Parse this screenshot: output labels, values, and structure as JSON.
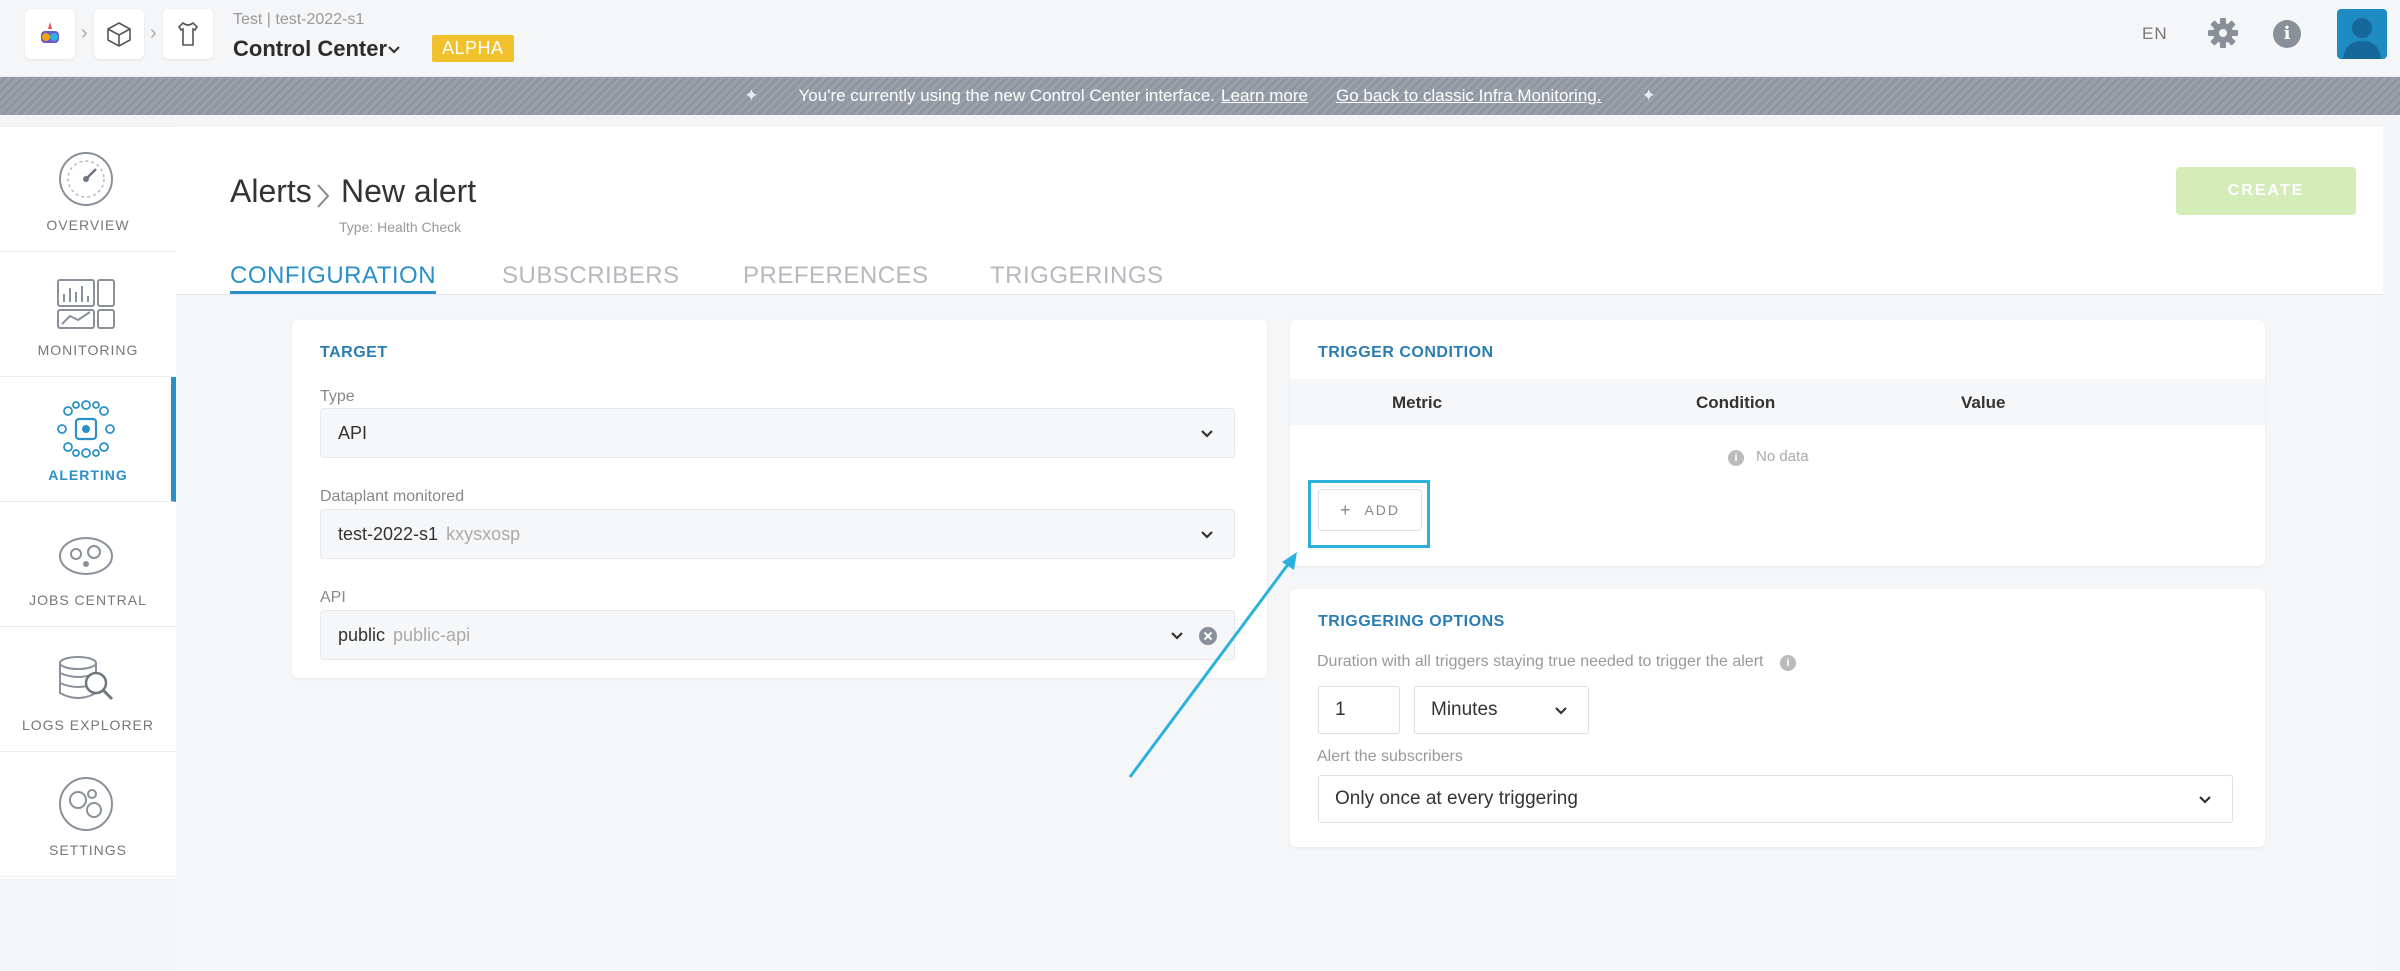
{
  "topbar": {
    "project_sub": "Test | test-2022-s1",
    "project_title": "Control Center",
    "badge": "ALPHA",
    "lang": "EN"
  },
  "banner": {
    "text": "You're currently using the new Control Center interface.",
    "learn_more": "Learn more",
    "go_back": "Go back to classic Infra Monitoring."
  },
  "sidebar": {
    "items": [
      {
        "label": "OVERVIEW",
        "icon": "gauge-icon"
      },
      {
        "label": "MONITORING",
        "icon": "monitoring-dashboard-icon"
      },
      {
        "label": "ALERTING",
        "icon": "alerting-network-icon"
      },
      {
        "label": "JOBS CENTRAL",
        "icon": "jobs-icon"
      },
      {
        "label": "LOGS EXPLORER",
        "icon": "logs-explorer-icon"
      },
      {
        "label": "SETTINGS",
        "icon": "settings-gears-icon"
      }
    ]
  },
  "header": {
    "breadcrumb_root": "Alerts",
    "breadcrumb_current": "New alert",
    "type_line": "Type: Health Check",
    "create_label": "CREATE"
  },
  "tabs": [
    "CONFIGURATION",
    "SUBSCRIBERS",
    "PREFERENCES",
    "TRIGGERINGS"
  ],
  "target": {
    "title": "TARGET",
    "type_label": "Type",
    "type_value": "API",
    "dataplant_label": "Dataplant monitored",
    "dataplant_value": "test-2022-s1",
    "dataplant_id": "kxysxosp",
    "api_label": "API",
    "api_value": "public",
    "api_id": "public-api"
  },
  "trigger_condition": {
    "title": "TRIGGER CONDITION",
    "columns": [
      "Metric",
      "Condition",
      "Value"
    ],
    "empty": "No data",
    "add_label": "ADD"
  },
  "triggering_options": {
    "title": "TRIGGERING OPTIONS",
    "duration_label": "Duration with all triggers staying true needed to trigger the alert",
    "duration_value": "1",
    "duration_unit": "Minutes",
    "alert_label": "Alert the subscribers",
    "alert_value": "Only once at every triggering"
  },
  "colors": {
    "accent": "#2a90c8",
    "highlight": "#2ab2dc",
    "create_disabled": "#d4ecb8",
    "alpha": "#f2c12e"
  }
}
